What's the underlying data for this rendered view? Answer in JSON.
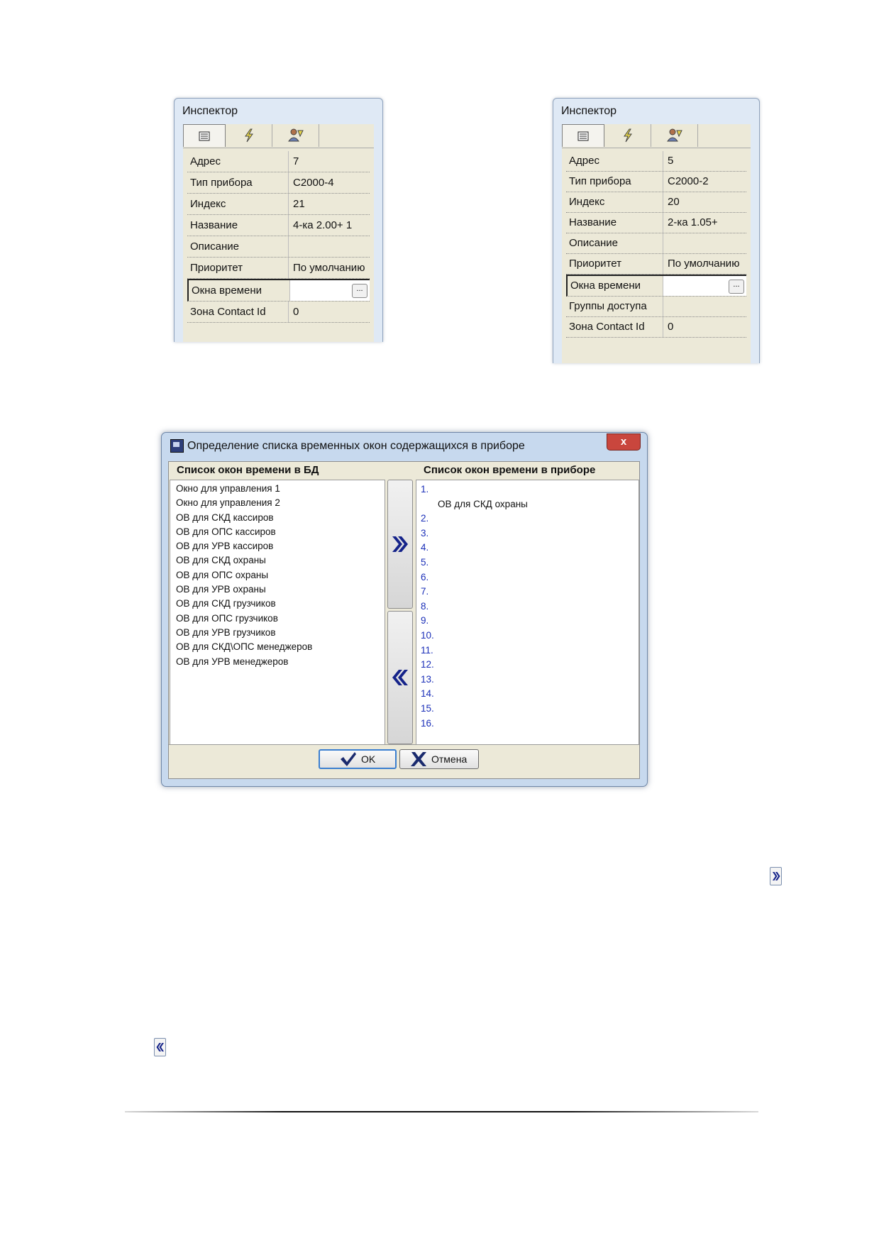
{
  "inspector_left": {
    "title": "Инспектор",
    "rows": [
      {
        "key": "Адрес",
        "value": "7"
      },
      {
        "key": "Тип прибора",
        "value": "С2000-4"
      },
      {
        "key": "Индекс",
        "value": "21"
      },
      {
        "key": "Название",
        "value": "4-ка 2.00+ 1"
      },
      {
        "key": "Описание",
        "value": ""
      },
      {
        "key": "Приоритет",
        "value": "По умолчанию"
      },
      {
        "key": "Окна времени",
        "value": ""
      },
      {
        "key": "Зона Contact Id",
        "value": "0"
      }
    ],
    "ellipsis": "..."
  },
  "inspector_right": {
    "title": "Инспектор",
    "rows": [
      {
        "key": "Адрес",
        "value": "5"
      },
      {
        "key": "Тип прибора",
        "value": "С2000-2"
      },
      {
        "key": "Индекс",
        "value": "20"
      },
      {
        "key": "Название",
        "value": "2-ка 1.05+"
      },
      {
        "key": "Описание",
        "value": ""
      },
      {
        "key": "Приоритет",
        "value": "По умолчанию"
      },
      {
        "key": "Окна времени",
        "value": ""
      },
      {
        "key": "Группы доступа",
        "value": ""
      },
      {
        "key": "Зона Contact Id",
        "value": "0"
      }
    ],
    "ellipsis": "..."
  },
  "dialog": {
    "title": "Определение списка временных окон содержащихся в приборе",
    "close": "x",
    "left_header": "Список окон времени в БД",
    "right_header": "Список окон времени в приборе",
    "db_windows": [
      "Окно для управления 1",
      "Окно для управления 2",
      "ОВ для СКД кассиров",
      "ОВ для ОПС кассиров",
      "ОВ для УРВ кассиров",
      "ОВ для СКД охраны",
      "ОВ для ОПС охраны",
      "ОВ для УРВ охраны",
      "ОВ для СКД грузчиков",
      "ОВ для ОПС грузчиков",
      "ОВ для УРВ грузчиков",
      "ОВ для СКД\\ОПС менеджеров",
      "ОВ для УРВ менеджеров"
    ],
    "device_slot_1": "1.",
    "device_slot_1_value": "ОВ для СКД охраны",
    "device_slots": [
      "2.",
      "3.",
      "4.",
      "5.",
      "6.",
      "7.",
      "8.",
      "9.",
      "10.",
      "11.",
      "12.",
      "13.",
      "14.",
      "15.",
      "16."
    ],
    "ok_label": "OK",
    "cancel_label": "Отмена"
  },
  "colors": {
    "arrow_blue": "#15238a",
    "slot_blue": "#1b2fb8",
    "cancel_x": "#1a2a6e",
    "ok_check": "#1a2a6e"
  }
}
